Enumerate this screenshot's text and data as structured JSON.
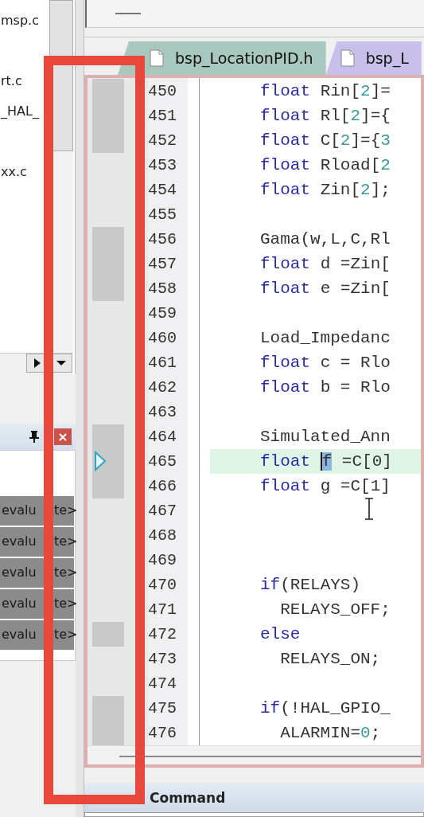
{
  "project_tree": {
    "items": [
      {
        "label": "msp.c"
      },
      {
        "label": "rt.c"
      },
      {
        "label": "_HAL_"
      },
      {
        "label": "xx.c"
      }
    ]
  },
  "watch": {
    "rows": [
      {
        "visible_parts": [
          "evalu",
          "te>"
        ]
      },
      {
        "visible_parts": [
          "evalu",
          "te>"
        ]
      },
      {
        "visible_parts": [
          "evalu",
          "te>"
        ]
      },
      {
        "visible_parts": [
          "evalu",
          "te>"
        ]
      },
      {
        "visible_parts": [
          "evalu",
          "te>"
        ]
      }
    ]
  },
  "editor": {
    "tabs": [
      {
        "label": "bsp_LocationPID.h",
        "selected": true
      },
      {
        "label": "bsp_L",
        "selected": false
      }
    ],
    "lines": [
      {
        "number": "450",
        "marked": true,
        "current": false,
        "tokens": [
          {
            "text": "float ",
            "kind": "keyword"
          },
          {
            "text": "Rin[",
            "kind": "plain"
          },
          {
            "text": "2",
            "kind": "number"
          },
          {
            "text": "]=",
            "kind": "plain"
          }
        ]
      },
      {
        "number": "451",
        "marked": true,
        "current": false,
        "tokens": [
          {
            "text": "float ",
            "kind": "keyword"
          },
          {
            "text": "Rl[",
            "kind": "plain"
          },
          {
            "text": "2",
            "kind": "number"
          },
          {
            "text": "]={",
            "kind": "plain"
          }
        ]
      },
      {
        "number": "452",
        "marked": true,
        "current": false,
        "tokens": [
          {
            "text": "float ",
            "kind": "keyword"
          },
          {
            "text": "C[",
            "kind": "plain"
          },
          {
            "text": "2",
            "kind": "number"
          },
          {
            "text": "]={",
            "kind": "plain"
          },
          {
            "text": "3",
            "kind": "number"
          }
        ]
      },
      {
        "number": "453",
        "marked": false,
        "current": false,
        "tokens": [
          {
            "text": "float ",
            "kind": "keyword"
          },
          {
            "text": "Rload[",
            "kind": "plain"
          },
          {
            "text": "2",
            "kind": "number"
          }
        ]
      },
      {
        "number": "454",
        "marked": false,
        "current": false,
        "tokens": [
          {
            "text": "float ",
            "kind": "keyword"
          },
          {
            "text": "Zin[",
            "kind": "plain"
          },
          {
            "text": "2",
            "kind": "number"
          },
          {
            "text": "];",
            "kind": "plain"
          }
        ]
      },
      {
        "number": "455",
        "marked": false,
        "current": false
      },
      {
        "number": "456",
        "marked": true,
        "current": false,
        "tokens": [
          {
            "text": "Gama(w,L,C,Rl",
            "kind": "plain"
          }
        ]
      },
      {
        "number": "457",
        "marked": true,
        "current": false,
        "tokens": [
          {
            "text": "float ",
            "kind": "keyword"
          },
          {
            "text": "d =Zin[",
            "kind": "plain"
          }
        ]
      },
      {
        "number": "458",
        "marked": true,
        "current": false,
        "tokens": [
          {
            "text": "float ",
            "kind": "keyword"
          },
          {
            "text": "e =Zin[",
            "kind": "plain"
          }
        ]
      },
      {
        "number": "459",
        "marked": false,
        "current": false
      },
      {
        "number": "460",
        "marked": false,
        "current": false,
        "tokens": [
          {
            "text": "Load_Impedanc",
            "kind": "plain"
          }
        ]
      },
      {
        "number": "461",
        "marked": false,
        "current": false,
        "tokens": [
          {
            "text": "float ",
            "kind": "keyword"
          },
          {
            "text": "c = Rlo",
            "kind": "plain"
          }
        ]
      },
      {
        "number": "462",
        "marked": false,
        "current": false,
        "tokens": [
          {
            "text": "float ",
            "kind": "keyword"
          },
          {
            "text": "b = Rlo",
            "kind": "plain"
          }
        ]
      },
      {
        "number": "463",
        "marked": false,
        "current": false
      },
      {
        "number": "464",
        "marked": true,
        "current": false,
        "tokens": [
          {
            "text": "Simulated_Ann",
            "kind": "plain"
          }
        ]
      },
      {
        "number": "465",
        "marked": true,
        "current": true,
        "tokens": [
          {
            "text": "float ",
            "kind": "keyword"
          },
          {
            "text": "f",
            "kind": "selected"
          },
          {
            "text": " =C[0]",
            "kind": "plain"
          }
        ]
      },
      {
        "number": "466",
        "marked": true,
        "current": false,
        "tokens": [
          {
            "text": "float ",
            "kind": "keyword"
          },
          {
            "text": "g =C[1]",
            "kind": "plain"
          }
        ]
      },
      {
        "number": "467",
        "marked": false,
        "current": false
      },
      {
        "number": "468",
        "marked": false,
        "current": false
      },
      {
        "number": "469",
        "marked": false,
        "current": false
      },
      {
        "number": "470",
        "marked": false,
        "current": false,
        "tokens": [
          {
            "text": "if",
            "kind": "keyword"
          },
          {
            "text": "(RELAYS)",
            "kind": "plain"
          }
        ]
      },
      {
        "number": "471",
        "marked": false,
        "current": false,
        "tokens": [
          {
            "text": "  RELAYS_OFF;",
            "kind": "plain"
          }
        ]
      },
      {
        "number": "472",
        "marked": true,
        "current": false,
        "tokens": [
          {
            "text": "else",
            "kind": "keyword"
          }
        ]
      },
      {
        "number": "473",
        "marked": false,
        "current": false,
        "tokens": [
          {
            "text": "  RELAYS_ON;",
            "kind": "plain"
          }
        ]
      },
      {
        "number": "474",
        "marked": false,
        "current": false
      },
      {
        "number": "475",
        "marked": true,
        "current": false,
        "tokens": [
          {
            "text": "if",
            "kind": "keyword"
          },
          {
            "text": "(!HAL_GPIO_",
            "kind": "plain"
          }
        ]
      },
      {
        "number": "476",
        "marked": true,
        "current": false,
        "tokens": [
          {
            "text": "  ALARMIN=",
            "kind": "plain"
          },
          {
            "text": "0",
            "kind": "number"
          },
          {
            "text": ";",
            "kind": "plain"
          }
        ]
      }
    ]
  },
  "command": {
    "title": "Command"
  }
}
